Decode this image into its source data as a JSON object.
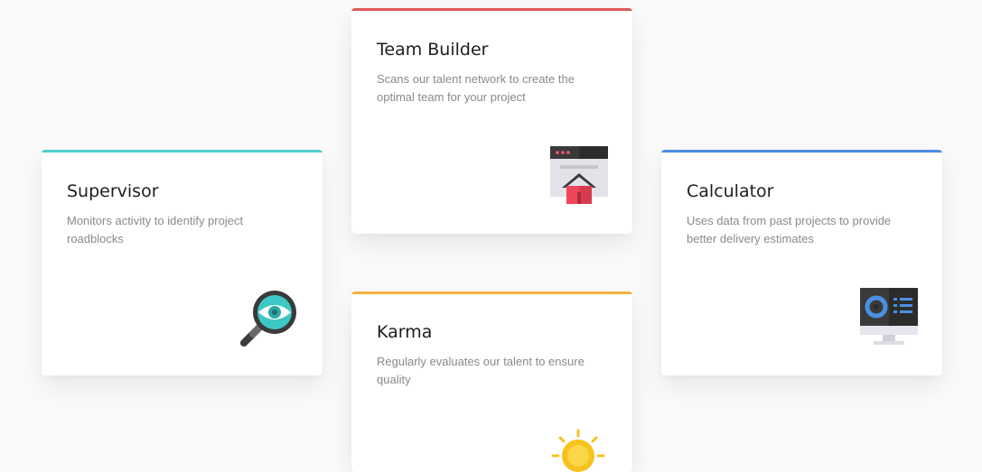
{
  "cards": [
    {
      "id": "supervisor",
      "title": "Supervisor",
      "description": "Monitors activity to identify project roadblocks",
      "accent": "#4fcfcf",
      "icon": "magnifier-eye-icon"
    },
    {
      "id": "team-builder",
      "title": "Team Builder",
      "description": "Scans our talent network to create the optimal team for your project",
      "accent": "#e05a5a",
      "icon": "browser-home-icon"
    },
    {
      "id": "calculator",
      "title": "Calculator",
      "description": "Uses data from past projects to provide better delivery estimates",
      "accent": "#4a8fe0",
      "icon": "monitor-dashboard-icon"
    },
    {
      "id": "karma",
      "title": "Karma",
      "description": "Regularly evaluates our talent to ensure quality",
      "accent": "#f5b041",
      "icon": "sun-badge-icon"
    }
  ]
}
